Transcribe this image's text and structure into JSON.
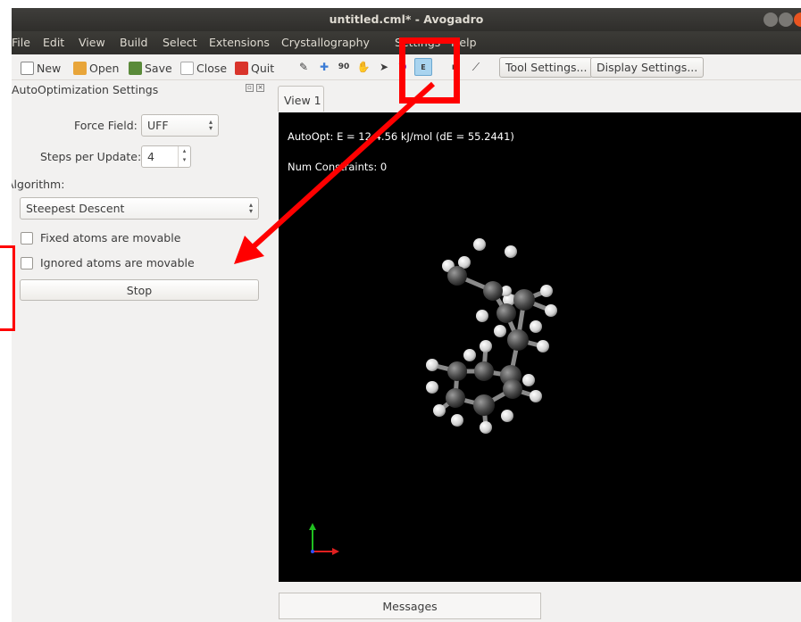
{
  "window": {
    "title": "untitled.cml* - Avogadro"
  },
  "menu": [
    "File",
    "Edit",
    "View",
    "Build",
    "Select",
    "Extensions",
    "Crystallography",
    "Settings",
    "Help"
  ],
  "toolbar": {
    "new_label": "New",
    "open_label": "Open",
    "save_label": "Save",
    "close_label": "Close",
    "quit_label": "Quit",
    "tool_settings_label": "Tool Settings...",
    "display_settings_label": "Display Settings..."
  },
  "dock": {
    "title": "AutoOptimization Settings",
    "force_field_label": "Force Field:",
    "force_field_value": "UFF",
    "steps_label": "Steps per Update:",
    "steps_value": "4",
    "algorithm_label": "Algorithm:",
    "algorithm_value": "Steepest Descent",
    "fixed_label": "Fixed atoms are movable",
    "ignored_label": "Ignored atoms are movable",
    "stop_label": "Stop"
  },
  "view": {
    "tab_label": "View 1",
    "energy_text": "AutoOpt: E = 12 4.56 kJ/mol (dE = 55.2441)",
    "constraints_text": "Num Constraints: 0"
  },
  "messages_label": "Messages",
  "colors": {
    "highlight": "#ff0000",
    "view_bg": "#000000",
    "titlebar": "#3c3b37"
  }
}
